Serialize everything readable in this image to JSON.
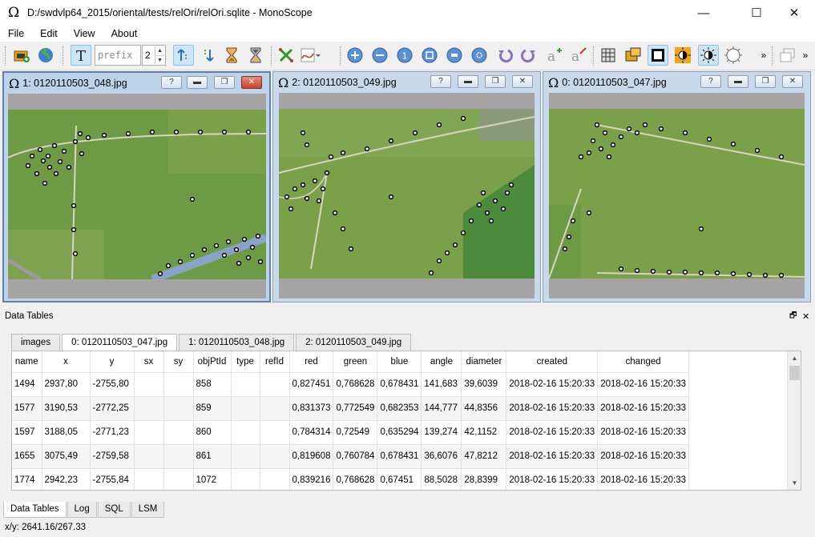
{
  "window": {
    "title": "D:/swdvlp64_2015/oriental/tests/relOri/relOri.sqlite - MonoScope",
    "icon": "omega-icon",
    "controls": {
      "minimize": "—",
      "maximize": "☐",
      "close": "✕"
    }
  },
  "menu": [
    "File",
    "Edit",
    "View",
    "About"
  ],
  "toolbar": {
    "prefix_placeholder": "prefix",
    "spin_value": "2",
    "overflow": "»"
  },
  "subwindows": [
    {
      "title": "1: 0120110503_048.jpg",
      "active": true
    },
    {
      "title": "2: 0120110503_049.jpg",
      "active": false
    },
    {
      "title": "0: 0120110503_047.jpg",
      "active": false
    }
  ],
  "subwindow_buttons": {
    "help": "?",
    "minimize": "▬",
    "restore": "❐",
    "close": "✕"
  },
  "dock": {
    "title": "Data Tables",
    "float": "🗗",
    "close": "✕"
  },
  "tabs": [
    "images",
    "0: 0120110503_047.jpg",
    "1: 0120110503_048.jpg",
    "2: 0120110503_049.jpg"
  ],
  "table": {
    "columns": [
      "name",
      "x",
      "y",
      "sx",
      "sy",
      "objPtId",
      "type",
      "refId",
      "red",
      "green",
      "blue",
      "angle",
      "diameter",
      "created",
      "changed"
    ],
    "rows": [
      [
        "1494",
        "2937,80",
        "-2755,80",
        "",
        "",
        "858",
        "",
        "",
        "0,827451",
        "0,768628",
        "0,678431",
        "141,683",
        "39,6039",
        "2018-02-16 15:20:33",
        "2018-02-16 15:20:33"
      ],
      [
        "1577",
        "3190,53",
        "-2772,25",
        "",
        "",
        "859",
        "",
        "",
        "0,831373",
        "0,772549",
        "0,682353",
        "144,777",
        "44,8356",
        "2018-02-16 15:20:33",
        "2018-02-16 15:20:33"
      ],
      [
        "1597",
        "3188,05",
        "-2771,23",
        "",
        "",
        "860",
        "",
        "",
        "0,784314",
        "0,72549",
        "0,635294",
        "139,274",
        "42,1152",
        "2018-02-16 15:20:33",
        "2018-02-16 15:20:33"
      ],
      [
        "1655",
        "3075,49",
        "-2759,58",
        "",
        "",
        "861",
        "",
        "",
        "0,819608",
        "0,760784",
        "0,678431",
        "36,6076",
        "47,8212",
        "2018-02-16 15:20:33",
        "2018-02-16 15:20:33"
      ],
      [
        "1774",
        "2942,23",
        "-2755,84",
        "",
        "",
        "1072",
        "",
        "",
        "0,839216",
        "0,768628",
        "0,67451",
        "88,5028",
        "28,8399",
        "2018-02-16 15:20:33",
        "2018-02-16 15:20:33"
      ]
    ]
  },
  "bottom_tabs": [
    "Data Tables",
    "Log",
    "SQL",
    "LSM"
  ],
  "status": "x/y: 2641.16/267.33",
  "colors": {
    "field_green": "#6f9a45",
    "track": "#d8d4c2",
    "active_frame": "#5d7fa9",
    "close_red": "#c8412c"
  }
}
